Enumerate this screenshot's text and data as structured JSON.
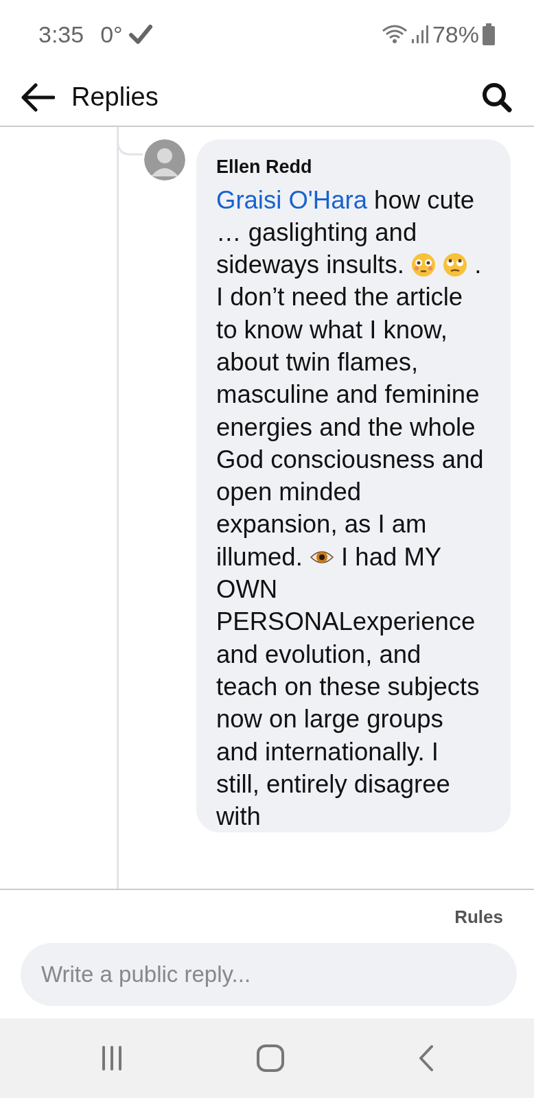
{
  "status_bar": {
    "time": "3:35",
    "temperature": "0°",
    "battery": "78%"
  },
  "header": {
    "title": "Replies"
  },
  "comment": {
    "author": "Ellen Redd",
    "body": [
      {
        "kind": "mention",
        "text": "Graisi O'Hara"
      },
      {
        "kind": "text",
        "text": " how cute … gaslighting and sideways insults. "
      },
      {
        "kind": "flushed"
      },
      {
        "kind": "eyeroll"
      },
      {
        "kind": "text",
        "text": ". I don’t need the article to know what I know, about twin flames, masculine and feminine energies and the whole God consciousness and open minded expansion, as I am illumed. "
      },
      {
        "kind": "eye"
      },
      {
        "kind": "text",
        "text": " I had MY OWN PERSONALexperience and evolution, and teach on these subjects now on large groups and internationally.  I still, entirely disagree with"
      }
    ]
  },
  "rules_link": "Rules",
  "reply_field": {
    "placeholder": "Write a public reply..."
  }
}
